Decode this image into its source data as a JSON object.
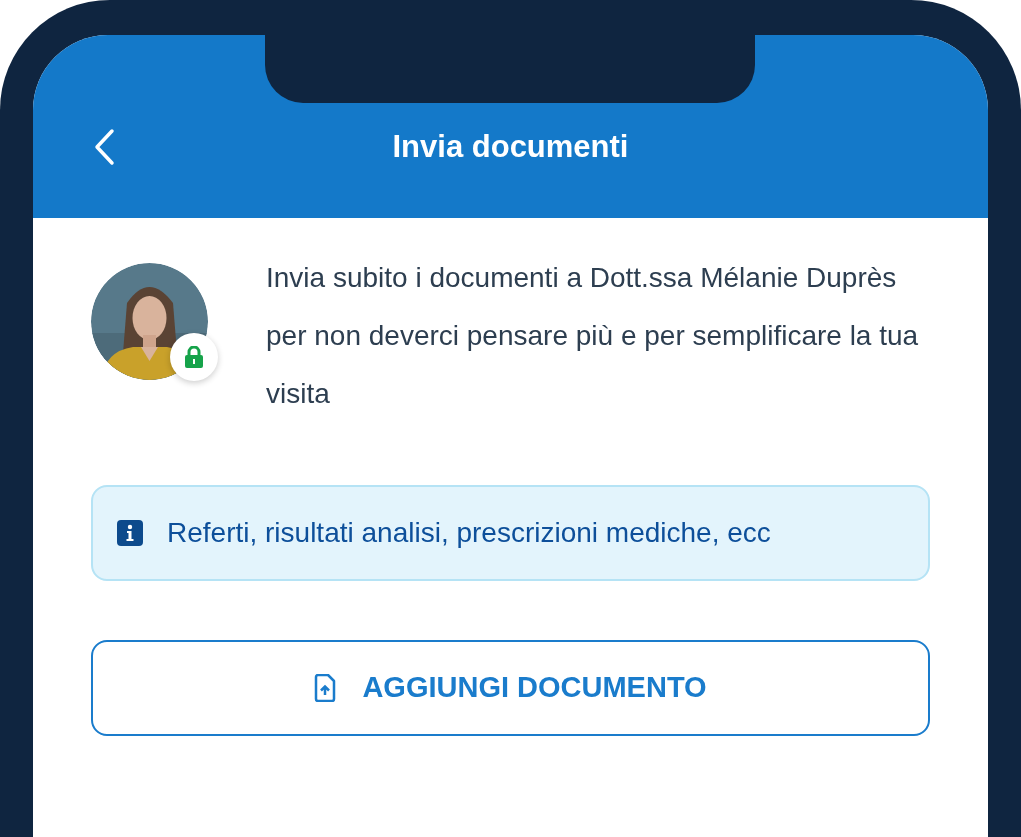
{
  "header": {
    "title": "Invia documenti"
  },
  "doctor": {
    "locked": true,
    "message": "Invia subito i documenti a Dott.ssa Mélanie Duprès per non deverci pensare più e per semplificare la tua visita"
  },
  "info_banner": {
    "text": "Referti, risultati analisi, prescrizioni mediche, ecc"
  },
  "add_button": {
    "label": "AGGIUNGI DOCUMENTO"
  }
}
